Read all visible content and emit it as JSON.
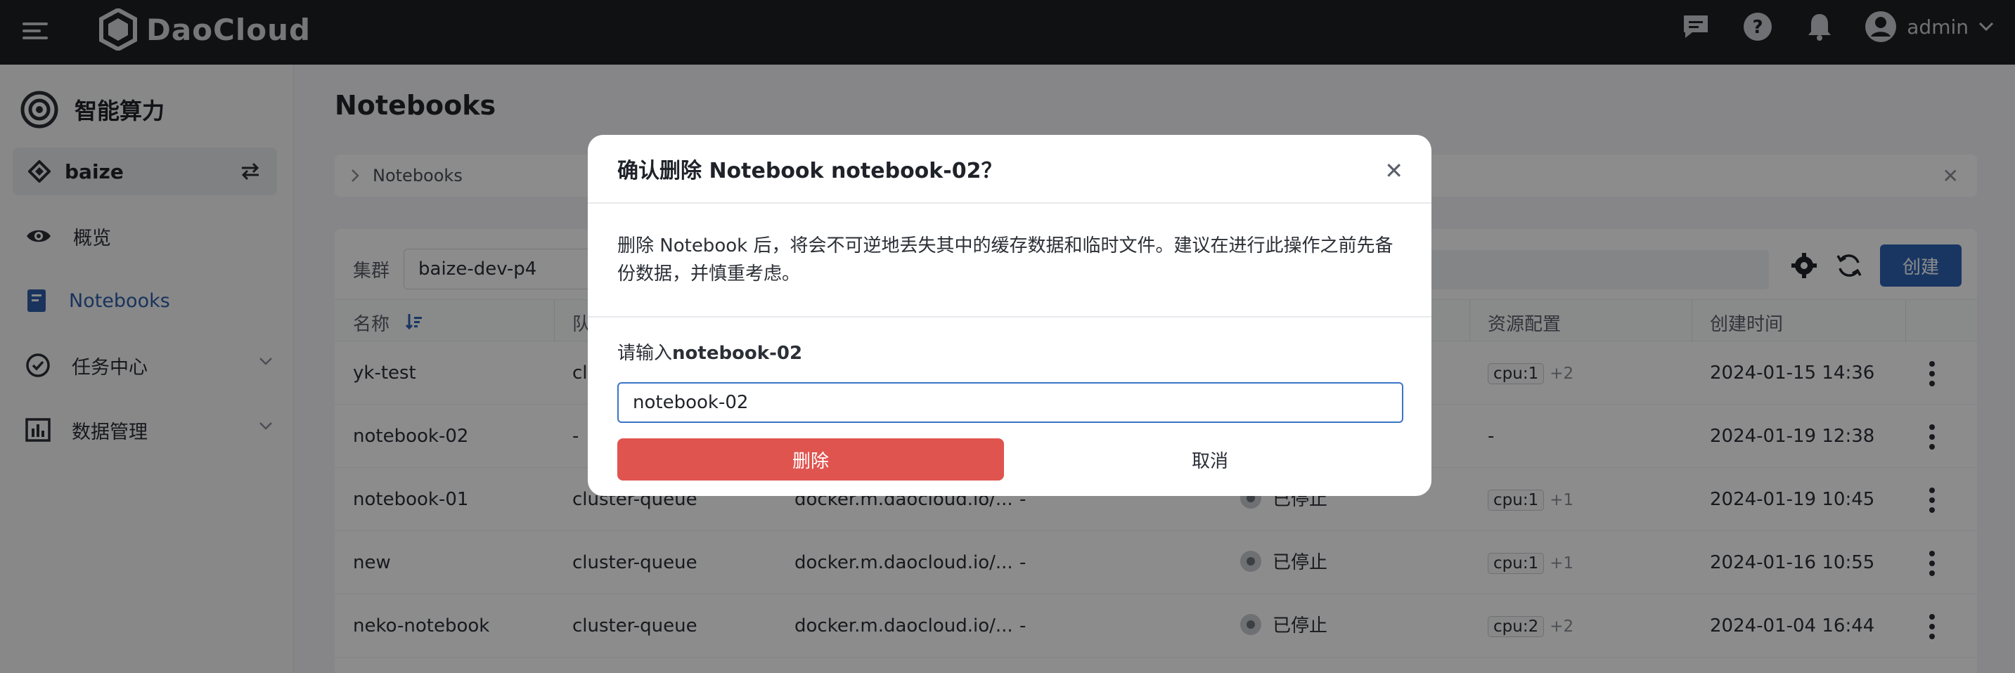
{
  "header": {
    "brand": "DaoCloud",
    "user": "admin",
    "icons": [
      "menu-icon",
      "chat-icon",
      "help-icon",
      "bell-icon",
      "user-icon",
      "chevron-down-icon"
    ]
  },
  "sidebar": {
    "title": "智能算力",
    "workspace": "baize",
    "items": [
      {
        "label": "概览",
        "icon": "eye-icon"
      },
      {
        "label": "Notebooks",
        "icon": "notebook-icon",
        "active": true
      },
      {
        "label": "任务中心",
        "icon": "check-circle-icon",
        "expandable": true
      },
      {
        "label": "数据管理",
        "icon": "data-icon",
        "expandable": true
      }
    ]
  },
  "main": {
    "title": "Notebooks",
    "breadcrumb": "Notebooks",
    "cluster_label": "集群",
    "cluster_value": "baize-dev-p4",
    "create_label": "创建",
    "columns": {
      "name": "名称",
      "queue": "队",
      "resources": "资源配置",
      "created": "创建时间"
    },
    "rows": [
      {
        "name": "yk-test",
        "queue": "cl",
        "image": "",
        "col4": "",
        "status": "",
        "cpu": "cpu:1",
        "more": "+2",
        "created": "2024-01-15 14:36"
      },
      {
        "name": "notebook-02",
        "queue": "-",
        "image": "",
        "col4": "",
        "status": "",
        "cpu": "",
        "more": "",
        "resources_text": "-",
        "created": "2024-01-19 12:38"
      },
      {
        "name": "notebook-01",
        "queue": "cluster-queue",
        "image": "docker.m.daocloud.io/...",
        "col4": "-",
        "status": "已停止",
        "cpu": "cpu:1",
        "more": "+1",
        "created": "2024-01-19 10:45"
      },
      {
        "name": "new",
        "queue": "cluster-queue",
        "image": "docker.m.daocloud.io/...",
        "col4": "-",
        "status": "已停止",
        "cpu": "cpu:1",
        "more": "+1",
        "created": "2024-01-16 10:55"
      },
      {
        "name": "neko-notebook",
        "queue": "cluster-queue",
        "image": "docker.m.daocloud.io/...",
        "col4": "-",
        "status": "已停止",
        "cpu": "cpu:2",
        "more": "+2",
        "created": "2024-01-04 16:44"
      }
    ]
  },
  "modal": {
    "title": "确认删除 Notebook notebook-02？",
    "message": "删除 Notebook 后，将会不可逆地丢失其中的缓存数据和临时文件。建议在进行此操作之前先备份数据，并慎重考虑。",
    "prompt_prefix": "请输入",
    "prompt_name": "notebook-02",
    "input_value": "notebook-02",
    "delete_label": "删除",
    "cancel_label": "取消"
  },
  "colors": {
    "accent": "#2f63b4",
    "danger": "#e0544f",
    "topbar": "#1e1f21"
  }
}
